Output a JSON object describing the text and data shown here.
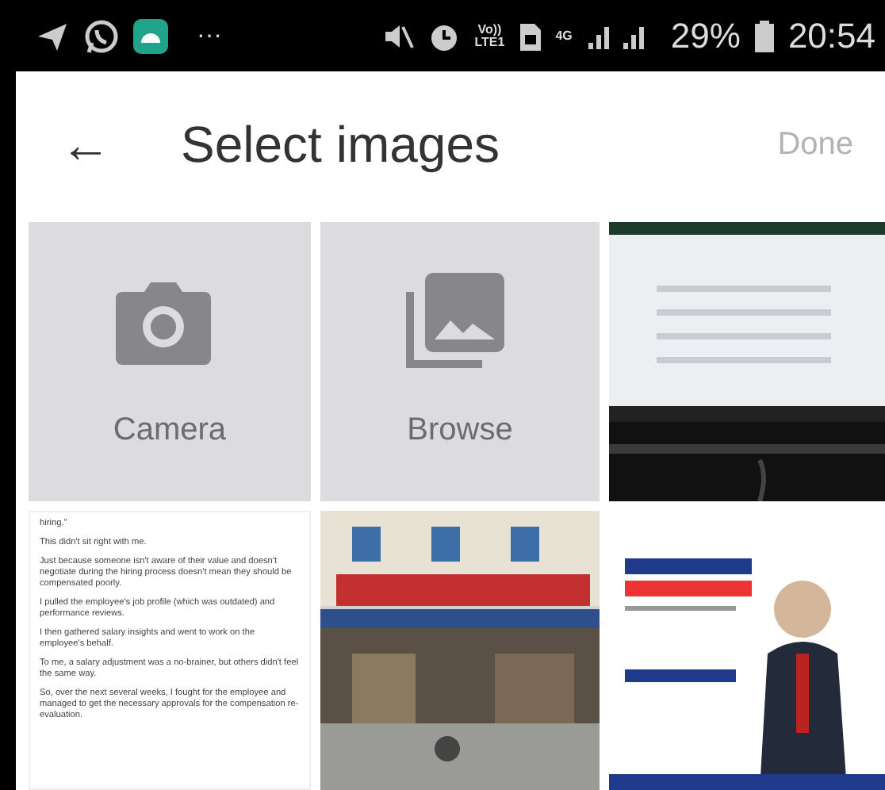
{
  "status_bar": {
    "more": "···",
    "volte": "Vo))",
    "volte_sub": "LTE1",
    "network": "4G",
    "battery": "29%",
    "time": "20:54"
  },
  "header": {
    "back": "←",
    "title": "Select images",
    "action": "Done",
    "action_disabled": true
  },
  "tiles": [
    {
      "kind": "action",
      "label": "Camera"
    },
    {
      "kind": "action",
      "label": "Browse"
    },
    {
      "kind": "picture"
    },
    {
      "kind": "document",
      "paragraphs": [
        "hiring.\"",
        "This didn't sit right with me.",
        "Just because someone isn't aware of their value and doesn't negotiate during the hiring process doesn't mean they should be compensated poorly.",
        "I pulled the employee's job profile (which was outdated) and performance reviews.",
        "I then gathered salary insights and went to work on the employee's behalf.",
        "To me, a salary adjustment was a no-brainer, but others didn't feel the same way.",
        "So, over the next several weeks, I fought for the employee and managed to get the necessary approvals for the compensation re-evaluation."
      ]
    },
    {
      "kind": "picture"
    },
    {
      "kind": "picture"
    }
  ]
}
